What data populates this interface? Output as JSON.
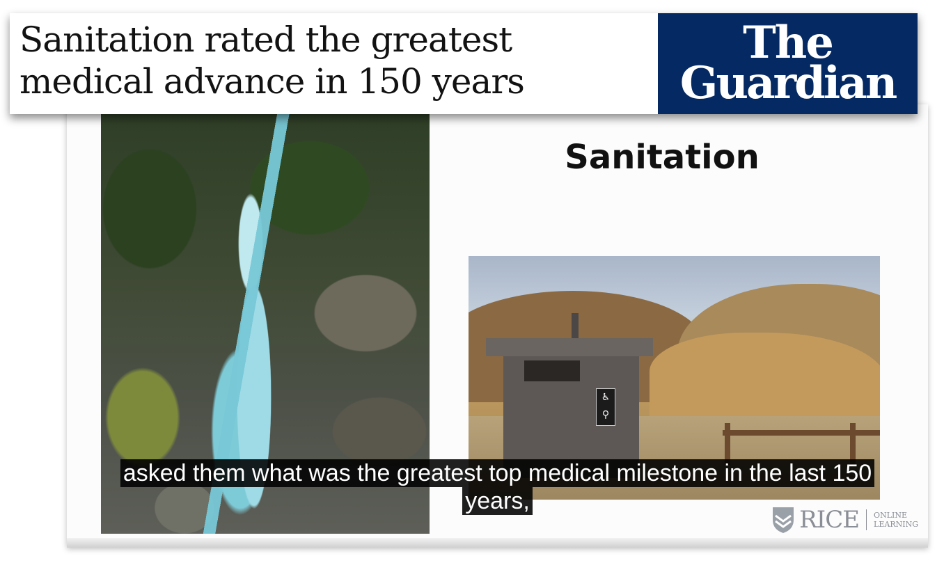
{
  "banner": {
    "headline": "Sanitation rated the greatest medical advance in 150 years",
    "logo_line1": "The",
    "logo_line2": "Guardian"
  },
  "slide": {
    "title": "Sanitation",
    "left_photo": "waterfall-photo",
    "right_photo": "outhouse-photo",
    "sign_icons": [
      "accessible-icon",
      "restroom-icon"
    ],
    "logo": {
      "name": "RICE",
      "sub_line1": "ONLINE",
      "sub_line2": "LEARNING"
    }
  },
  "captions": {
    "line1": "asked them what was the greatest top medical milestone in the last 150",
    "line2": "years,"
  }
}
